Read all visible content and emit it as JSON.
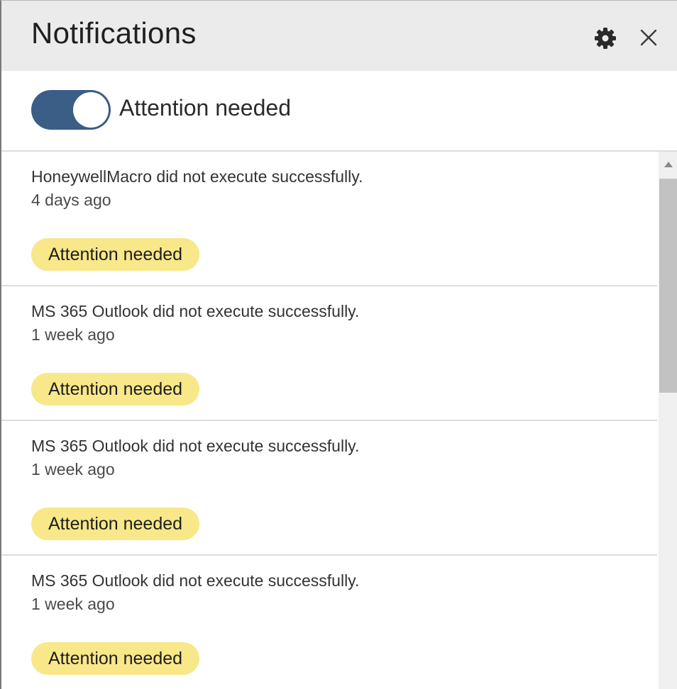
{
  "header": {
    "title": "Notifications",
    "settings_icon": "gear-icon",
    "close_icon": "close-icon"
  },
  "filter": {
    "toggle_on": true,
    "label": "Attention needed",
    "toggle_color": "#3a5e86"
  },
  "notifications": [
    {
      "message": "HoneywellMacro did not execute successfully.",
      "time": "4 days ago",
      "badge": "Attention needed"
    },
    {
      "message": "MS 365 Outlook did not execute successfully.",
      "time": "1 week ago",
      "badge": "Attention needed"
    },
    {
      "message": "MS 365 Outlook did not execute successfully.",
      "time": "1 week ago",
      "badge": "Attention needed"
    },
    {
      "message": "MS 365 Outlook did not execute successfully.",
      "time": "1 week ago",
      "badge": "Attention needed"
    }
  ],
  "colors": {
    "badge_background": "#f8e88a",
    "header_background": "#ebebeb"
  }
}
